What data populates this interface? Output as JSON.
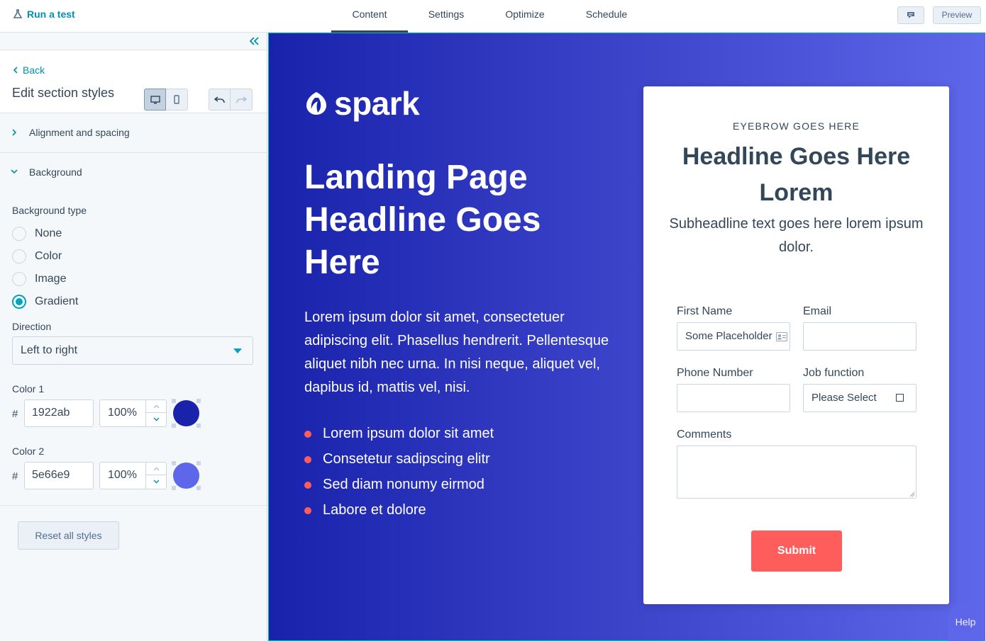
{
  "topbar": {
    "run_test": "Run a test",
    "tabs": [
      "Content",
      "Settings",
      "Optimize",
      "Schedule"
    ],
    "active_tab": "Content",
    "preview": "Preview"
  },
  "sidebar": {
    "back": "Back",
    "title": "Edit section styles",
    "sections": {
      "alignment": "Alignment and spacing",
      "background": "Background"
    },
    "background_type_label": "Background type",
    "background_options": [
      "None",
      "Color",
      "Image",
      "Gradient"
    ],
    "background_selected": "Gradient",
    "direction_label": "Direction",
    "direction_value": "Left to right",
    "color1": {
      "label": "Color 1",
      "hash": "#",
      "hex": "1922ab",
      "opacity": "100%",
      "swatch": "#1922ab"
    },
    "color2": {
      "label": "Color 2",
      "hash": "#",
      "hex": "5e66e9",
      "opacity": "100%",
      "swatch": "#5e66e9"
    },
    "reset": "Reset all styles"
  },
  "canvas": {
    "logo": "spark",
    "hero_title": "Landing Page Headline Goes Here",
    "hero_body": "Lorem ipsum dolor sit amet, consectetuer adipiscing elit. Phasellus hendrerit. Pellentesque aliquet nibh nec urna. In nisi neque, aliquet vel, dapibus id, mattis vel, nisi.",
    "bullets": [
      "Lorem ipsum dolor sit amet",
      "Consetetur sadipscing elitr",
      "Sed diam nonumy eirmod",
      "Labore et dolore"
    ],
    "form": {
      "eyebrow": "EYEBROW GOES HERE",
      "headline": "Headline Goes Here Lorem",
      "subheadline": "Subheadline text goes here lorem ipsum dolor.",
      "first_name_label": "First Name",
      "first_name_value": "Some Placeholder",
      "email_label": "Email",
      "phone_label": "Phone Number",
      "job_label": "Job function",
      "job_value": "Please Select",
      "comments_label": "Comments",
      "submit": "Submit"
    },
    "help": "Help"
  },
  "colors": {
    "accent": "#00a4bd",
    "link": "#0091ae",
    "gradient_start": "#1922ab",
    "gradient_end": "#5e66e9",
    "submit": "#ff5c5c"
  }
}
